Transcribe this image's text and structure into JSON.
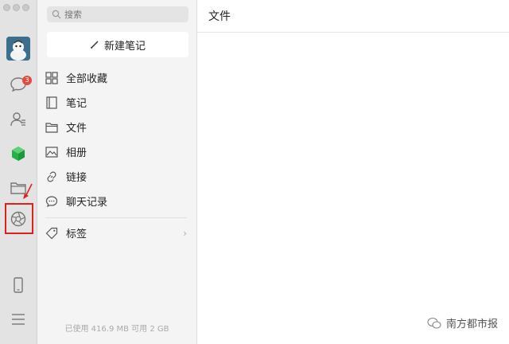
{
  "sidebar": {
    "chat_badge": "3",
    "icons": [
      "chat-icon",
      "contacts-icon",
      "mini-program-icon",
      "folder-icon",
      "favorites-icon",
      "phone-icon",
      "menu-icon"
    ]
  },
  "panel": {
    "search_placeholder": "搜索",
    "new_note_label": "新建笔记",
    "items": [
      {
        "label": "全部收藏",
        "icon": "grid-icon"
      },
      {
        "label": "笔记",
        "icon": "notebook-icon"
      },
      {
        "label": "文件",
        "icon": "folder-icon"
      },
      {
        "label": "相册",
        "icon": "image-icon"
      },
      {
        "label": "链接",
        "icon": "link-icon"
      },
      {
        "label": "聊天记录",
        "icon": "chat-record-icon"
      }
    ],
    "tags_label": "标签",
    "storage_text": "已使用 416.9 MB 可用 2 GB"
  },
  "main": {
    "title": "文件"
  },
  "watermark": {
    "text": "南方都市报"
  },
  "colors": {
    "highlight": "#e02020",
    "badge": "#e24c3f",
    "green_cube": "#22b14c"
  }
}
